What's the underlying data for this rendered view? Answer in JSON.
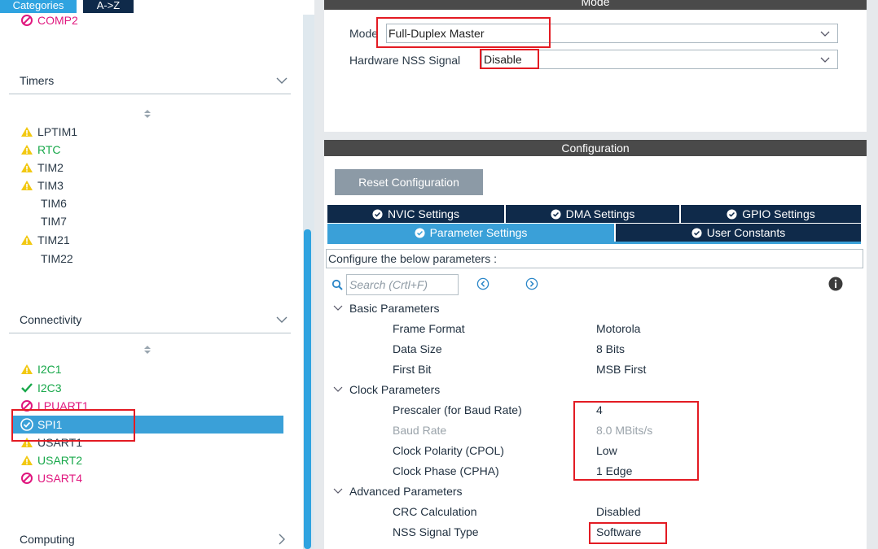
{
  "left_panel": {
    "tabs": [
      {
        "label": "Categories"
      },
      {
        "label": "A->Z"
      }
    ],
    "top_item": {
      "label": "COMP2",
      "status": "disabled"
    },
    "timers": {
      "header": "Timers",
      "items": [
        {
          "label": "LPTIM1",
          "status": "warning"
        },
        {
          "label": "RTC",
          "status": "warning"
        },
        {
          "label": "TIM2",
          "status": "warning"
        },
        {
          "label": "TIM3",
          "status": "warning"
        },
        {
          "label": "TIM6",
          "status": "none"
        },
        {
          "label": "TIM7",
          "status": "none"
        },
        {
          "label": "TIM21",
          "status": "warning"
        },
        {
          "label": "TIM22",
          "status": "none"
        }
      ]
    },
    "connectivity": {
      "header": "Connectivity",
      "items": [
        {
          "label": "I2C1",
          "status": "warning"
        },
        {
          "label": "I2C3",
          "status": "ok"
        },
        {
          "label": "LPUART1",
          "status": "disabled"
        },
        {
          "label": "SPI1",
          "status": "selected"
        },
        {
          "label": "USART1",
          "status": "warning"
        },
        {
          "label": "USART2",
          "status": "warning"
        },
        {
          "label": "USART4",
          "status": "disabled"
        }
      ]
    },
    "computing": {
      "header": "Computing"
    }
  },
  "mode_panel": {
    "title": "Mode",
    "mode_label": "Mode",
    "mode_value": "Full-Duplex Master",
    "nss_label": "Hardware NSS Signal",
    "nss_value": "Disable"
  },
  "config_panel": {
    "title": "Configuration",
    "reset_label": "Reset Configuration",
    "tabs_row1": [
      {
        "label": "NVIC Settings"
      },
      {
        "label": "DMA Settings"
      },
      {
        "label": "GPIO Settings"
      }
    ],
    "tabs_row2": [
      {
        "label": "Parameter Settings",
        "active": true
      },
      {
        "label": "User Constants",
        "active": false
      }
    ],
    "hint": "Configure the below parameters :",
    "search_placeholder": "Search (Crtl+F)",
    "groups": [
      {
        "name": "Basic Parameters",
        "params": [
          {
            "name": "Frame Format",
            "value": "Motorola"
          },
          {
            "name": "Data Size",
            "value": "8 Bits"
          },
          {
            "name": "First Bit",
            "value": "MSB First"
          }
        ]
      },
      {
        "name": "Clock Parameters",
        "params": [
          {
            "name": "Prescaler (for Baud Rate)",
            "value": "4"
          },
          {
            "name": "Baud Rate",
            "value": "8.0 MBits/s",
            "disabled": true
          },
          {
            "name": "Clock Polarity (CPOL)",
            "value": "Low"
          },
          {
            "name": "Clock Phase (CPHA)",
            "value": "1 Edge"
          }
        ]
      },
      {
        "name": "Advanced Parameters",
        "params": [
          {
            "name": "CRC Calculation",
            "value": "Disabled"
          },
          {
            "name": "NSS Signal Type",
            "value": "Software"
          }
        ]
      }
    ]
  },
  "colors": {
    "accent_blue": "#3aa0d8",
    "dark_navy": "#0f2a4a",
    "title_bar": "#4a4a4a",
    "warning_text": "#18a84a",
    "disabled_text": "#e0177e",
    "highlight_red": "#e31b23"
  }
}
